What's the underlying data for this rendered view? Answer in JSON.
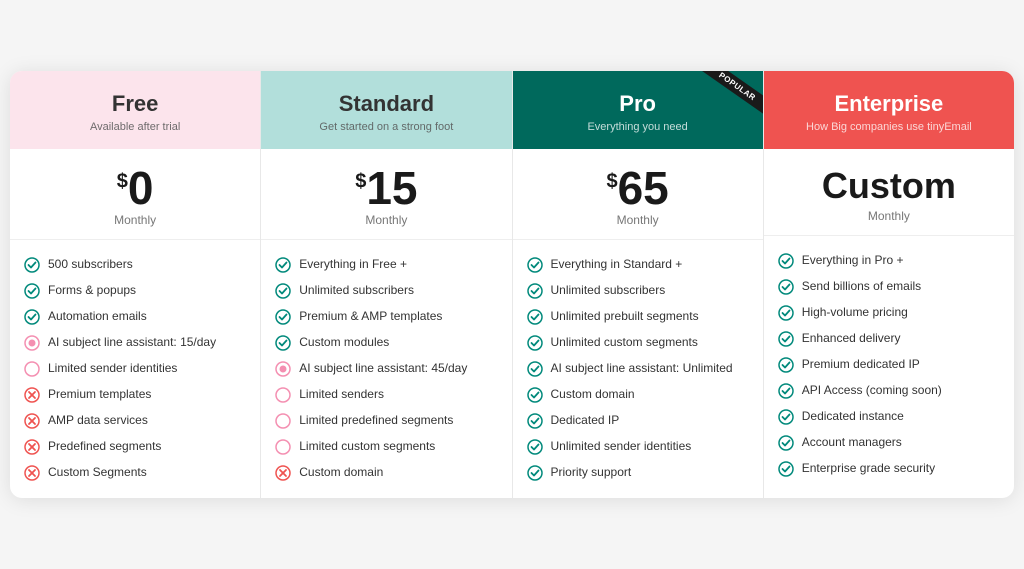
{
  "plans": [
    {
      "id": "free",
      "name": "Free",
      "tagline": "Available after trial",
      "headerClass": "free",
      "price": "0",
      "pricePrefix": "$",
      "period": "Monthly",
      "popular": false,
      "features": [
        {
          "icon": "check",
          "text": "500 subscribers"
        },
        {
          "icon": "check",
          "text": "Forms & popups"
        },
        {
          "icon": "check",
          "text": "Automation emails"
        },
        {
          "icon": "circle",
          "text": "AI subject line assistant: 15/day"
        },
        {
          "icon": "circle-outline",
          "text": "Limited sender identities"
        },
        {
          "icon": "x",
          "text": "Premium templates"
        },
        {
          "icon": "x",
          "text": "AMP data services"
        },
        {
          "icon": "x",
          "text": "Predefined segments"
        },
        {
          "icon": "x",
          "text": "Custom Segments"
        }
      ]
    },
    {
      "id": "standard",
      "name": "Standard",
      "tagline": "Get started on a strong foot",
      "headerClass": "standard",
      "price": "15",
      "pricePrefix": "$",
      "period": "Monthly",
      "popular": false,
      "features": [
        {
          "icon": "check",
          "text": "Everything in Free +"
        },
        {
          "icon": "check",
          "text": "Unlimited subscribers"
        },
        {
          "icon": "check",
          "text": "Premium & AMP templates"
        },
        {
          "icon": "check",
          "text": "Custom modules"
        },
        {
          "icon": "circle",
          "text": "AI subject line assistant: 45/day"
        },
        {
          "icon": "circle-outline",
          "text": "Limited senders"
        },
        {
          "icon": "circle-outline",
          "text": "Limited predefined segments"
        },
        {
          "icon": "circle-outline",
          "text": "Limited custom segments"
        },
        {
          "icon": "x",
          "text": "Custom domain"
        }
      ]
    },
    {
      "id": "pro",
      "name": "Pro",
      "tagline": "Everything you need",
      "headerClass": "pro",
      "price": "65",
      "pricePrefix": "$",
      "period": "Monthly",
      "popular": true,
      "popularLabel": "POPULAR",
      "features": [
        {
          "icon": "check",
          "text": "Everything in Standard +"
        },
        {
          "icon": "check",
          "text": "Unlimited subscribers"
        },
        {
          "icon": "check",
          "text": "Unlimited prebuilt segments"
        },
        {
          "icon": "check",
          "text": "Unlimited custom segments"
        },
        {
          "icon": "check",
          "text": "AI subject line assistant: Unlimited"
        },
        {
          "icon": "check",
          "text": "Custom domain"
        },
        {
          "icon": "check",
          "text": "Dedicated IP"
        },
        {
          "icon": "check",
          "text": "Unlimited sender identities"
        },
        {
          "icon": "check",
          "text": "Priority support"
        }
      ]
    },
    {
      "id": "enterprise",
      "name": "Enterprise",
      "tagline": "How Big companies use tinyEmail",
      "headerClass": "enterprise",
      "priceCustom": "Custom",
      "period": "Monthly",
      "popular": false,
      "features": [
        {
          "icon": "check",
          "text": "Everything in Pro +"
        },
        {
          "icon": "check",
          "text": "Send billions of emails"
        },
        {
          "icon": "check",
          "text": "High-volume pricing"
        },
        {
          "icon": "check",
          "text": "Enhanced delivery"
        },
        {
          "icon": "check",
          "text": "Premium dedicated IP"
        },
        {
          "icon": "check",
          "text": "API Access (coming soon)"
        },
        {
          "icon": "check",
          "text": "Dedicated instance"
        },
        {
          "icon": "check",
          "text": "Account managers"
        },
        {
          "icon": "check",
          "text": "Enterprise grade security"
        }
      ]
    }
  ]
}
